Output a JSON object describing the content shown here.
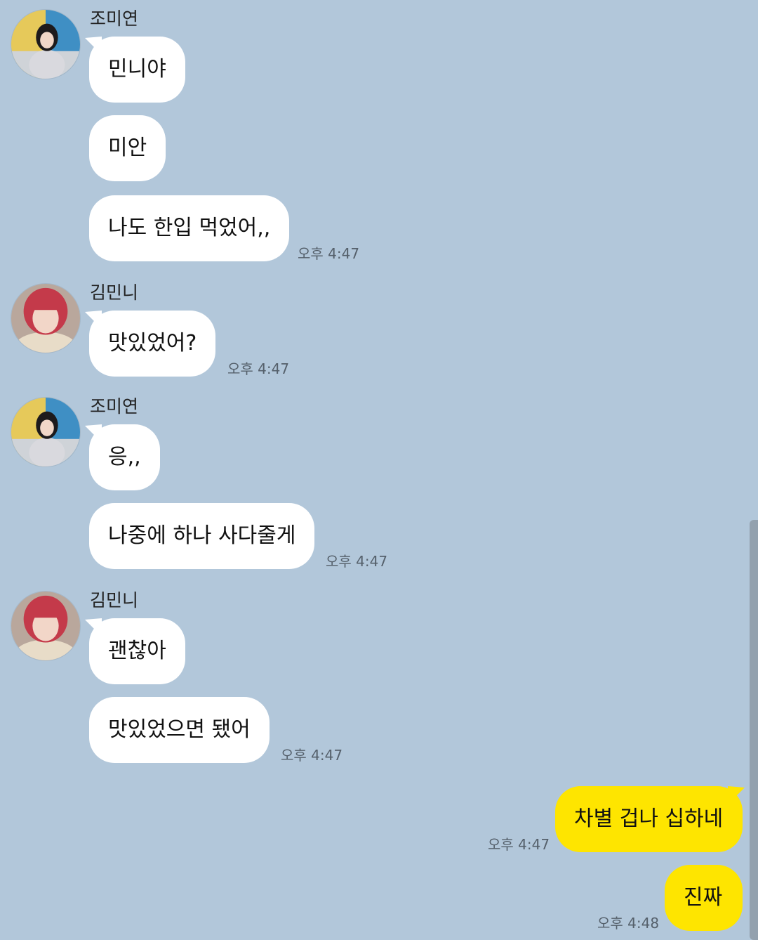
{
  "messages": [
    {
      "sender": "조미연",
      "bubbles": [
        "민니야",
        "미안",
        "나도 한입 먹었어,,"
      ],
      "time": "오후 4:47"
    },
    {
      "sender": "김민니",
      "bubbles": [
        "맛있었어?"
      ],
      "time": "오후 4:47"
    },
    {
      "sender": "조미연",
      "bubbles": [
        "응,,",
        "나중에 하나 사다줄게"
      ],
      "time": "오후 4:47"
    },
    {
      "sender": "김민니",
      "bubbles": [
        "괜찮아",
        "맛있었으면 됐어"
      ],
      "time": "오후 4:47"
    },
    {
      "sender": "me",
      "bubbles": [
        "차별 겁나 십하네"
      ],
      "time": "오후 4:47"
    },
    {
      "sender": "me",
      "bubbles": [
        "진짜"
      ],
      "time": "오후 4:48"
    }
  ],
  "colors": {
    "background": "#b2c7da",
    "incoming_bubble": "#ffffff",
    "outgoing_bubble": "#fee500"
  }
}
